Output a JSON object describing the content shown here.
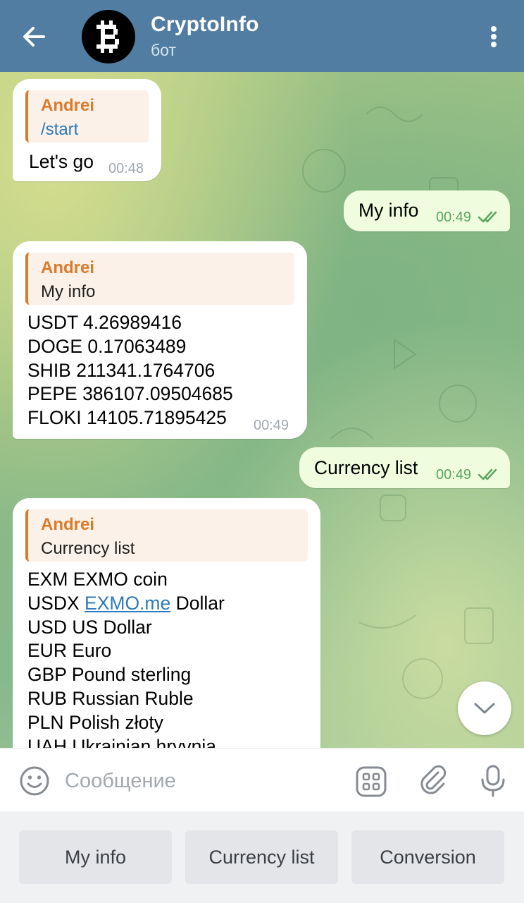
{
  "header": {
    "title": "CryptoInfo",
    "subtitle": "бот"
  },
  "messages": [
    {
      "direction": "in",
      "reply_name": "Andrei",
      "reply_text": "/start",
      "text": "Let's go",
      "time": "00:48"
    },
    {
      "direction": "out",
      "text": "My info",
      "time": "00:49",
      "status": "read"
    },
    {
      "direction": "in",
      "reply_name": "Andrei",
      "reply_text": "My info",
      "lines": [
        "USDT 4.26989416",
        "DOGE 0.17063489",
        "SHIB 211341.1764706",
        "PEPE 386107.09504685",
        "FLOKI 14105.71895425"
      ],
      "time": "00:49"
    },
    {
      "direction": "out",
      "text": "Currency list",
      "time": "00:49",
      "status": "read"
    },
    {
      "direction": "in",
      "reply_name": "Andrei",
      "reply_text": "Currency list",
      "lines": [
        "EXM EXMO coin",
        "USDX",
        "USD US Dollar",
        "EUR Euro",
        "GBP Pound sterling",
        "RUB Russian Ruble",
        "PLN Polish złoty",
        "UAH Ukrainian hryvnia"
      ],
      "link": "EXMO.me",
      "link_suffix": "Dollar"
    }
  ],
  "input": {
    "placeholder": "Сообщение"
  },
  "keyboard": {
    "buttons": [
      "My info",
      "Currency list",
      "Conversion"
    ]
  },
  "icons": {
    "back": "arrow-left-icon",
    "menu": "kebab-menu-icon",
    "scroll": "chevron-down-icon",
    "emoji": "emoji-smile-icon",
    "bot_commands": "bot-commands-grid-icon",
    "attach": "paperclip-icon",
    "mic": "microphone-icon",
    "read": "double-check-icon"
  },
  "colors": {
    "header": "#517da2",
    "reply_accent": "#dc7a2a",
    "link": "#2e7ab8",
    "outgoing_bubble": "#effdde",
    "outgoing_time": "#5aa562"
  }
}
